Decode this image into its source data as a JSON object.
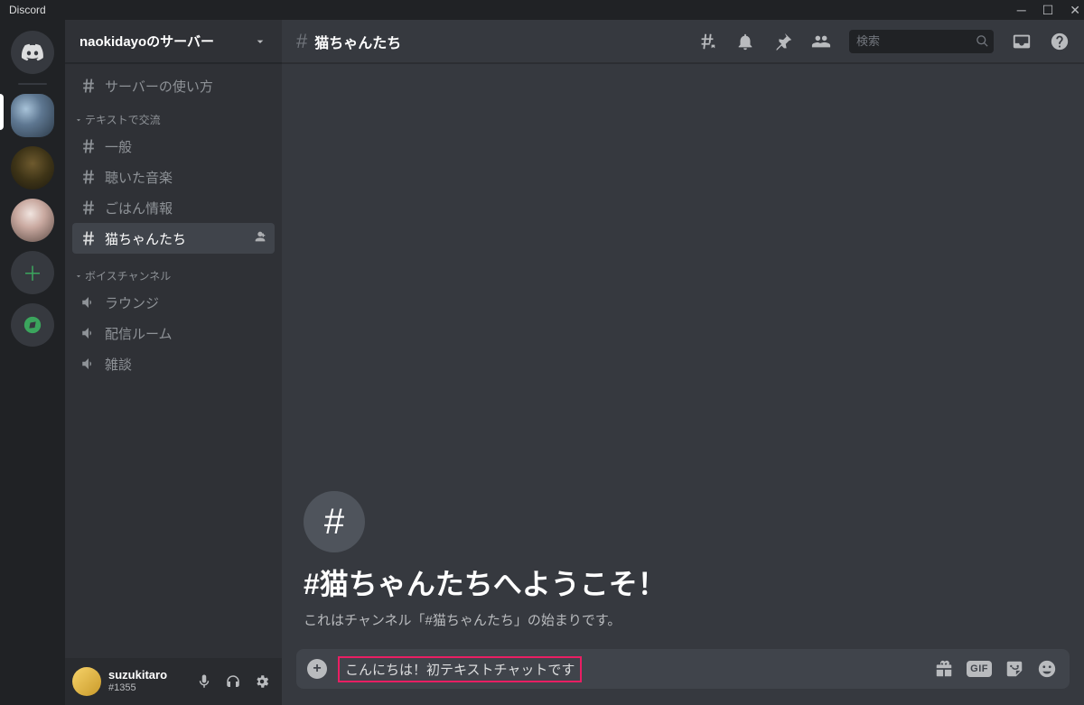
{
  "titlebar": {
    "app_name": "Discord"
  },
  "server": {
    "name": "naokidayoのサーバー"
  },
  "categories": {
    "top_channel": "サーバーの使い方",
    "text_category": "テキストで交流",
    "text_channels": [
      "一般",
      "聴いた音楽",
      "ごはん情報",
      "猫ちゃんたち"
    ],
    "voice_category": "ボイスチャンネル",
    "voice_channels": [
      "ラウンジ",
      "配信ルーム",
      "雑談"
    ]
  },
  "user": {
    "name": "suzukitaro",
    "tag": "#1355"
  },
  "header": {
    "channel_name": "猫ちゃんたち",
    "search_placeholder": "検索"
  },
  "welcome": {
    "title": "#猫ちゃんたちへようこそ！",
    "subtitle": "これはチャンネル「#猫ちゃんたち」の始まりです。"
  },
  "composer": {
    "value": "こんにちは！初テキストチャットです",
    "gif_label": "GIF"
  }
}
